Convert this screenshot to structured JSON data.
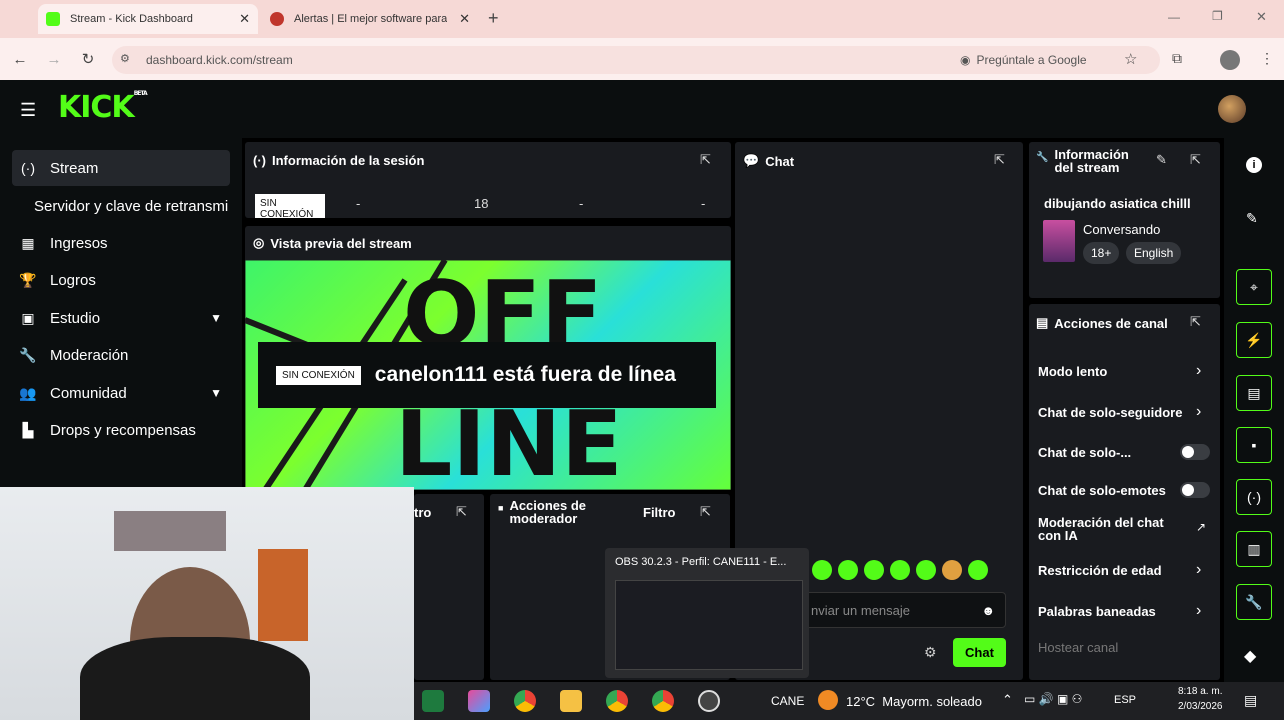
{
  "browser": {
    "tabs": [
      {
        "title": "Stream - Kick Dashboard"
      },
      {
        "title": "Alertas | El mejor software para"
      }
    ],
    "url": "dashboard.kick.com/stream",
    "ask_google": "Pregúntale a Google"
  },
  "kick": {
    "logo": "KICK",
    "logo_badge": "BETA"
  },
  "sidebar": {
    "items": [
      {
        "label": "Stream",
        "icon": "broadcast-icon"
      },
      {
        "label": "Servidor y clave de retransmi"
      },
      {
        "label": "Ingresos",
        "icon": "money-icon"
      },
      {
        "label": "Logros",
        "icon": "trophy-icon"
      },
      {
        "label": "Estudio",
        "icon": "studio-icon"
      },
      {
        "label": "Moderación",
        "icon": "wrench-icon"
      },
      {
        "label": "Comunidad",
        "icon": "community-icon"
      },
      {
        "label": "Drops y recompensas",
        "icon": "drops-icon"
      }
    ]
  },
  "session": {
    "title": "Información de la sesión",
    "status_badge": "SIN CONEXIÓN",
    "stats": [
      "-",
      "18",
      "-",
      "-"
    ]
  },
  "preview": {
    "title": "Vista previa del stream",
    "badge": "SIN CONEXIÓN",
    "message": "canelon111 está fuera de línea",
    "offline_art_top": "OFF",
    "offline_art_bottom": "LINE"
  },
  "chat": {
    "title": "Chat",
    "placeholder": "nviar un mensaje",
    "send_label": "Chat"
  },
  "lower_panels": {
    "left_partial_label": "tro",
    "mod_actions_title": "Acciones de moderador",
    "filter_label": "Filtro"
  },
  "stream_info": {
    "title": "Información del stream",
    "stream_title": "dibujando asiatica chilll",
    "category": "Conversando",
    "tags": [
      "18+",
      "English"
    ]
  },
  "channel_actions": {
    "title": "Acciones de canal",
    "items": [
      "Modo lento",
      "Chat de solo-seguidore",
      "Chat de solo-...",
      "Chat de solo-emotes",
      "Moderación del chat con IA",
      "Restricción de edad",
      "Palabras baneadas",
      "Hostear canal"
    ]
  },
  "obs_popup": {
    "title": "OBS 30.2.3 - Perfil: CANE111 - E..."
  },
  "taskbar": {
    "user_label": "CANE",
    "weather": "12°C  Mayorm. soleado",
    "lang": "ESP",
    "time": "8:18 a. m.",
    "date": "2/03/2026"
  }
}
